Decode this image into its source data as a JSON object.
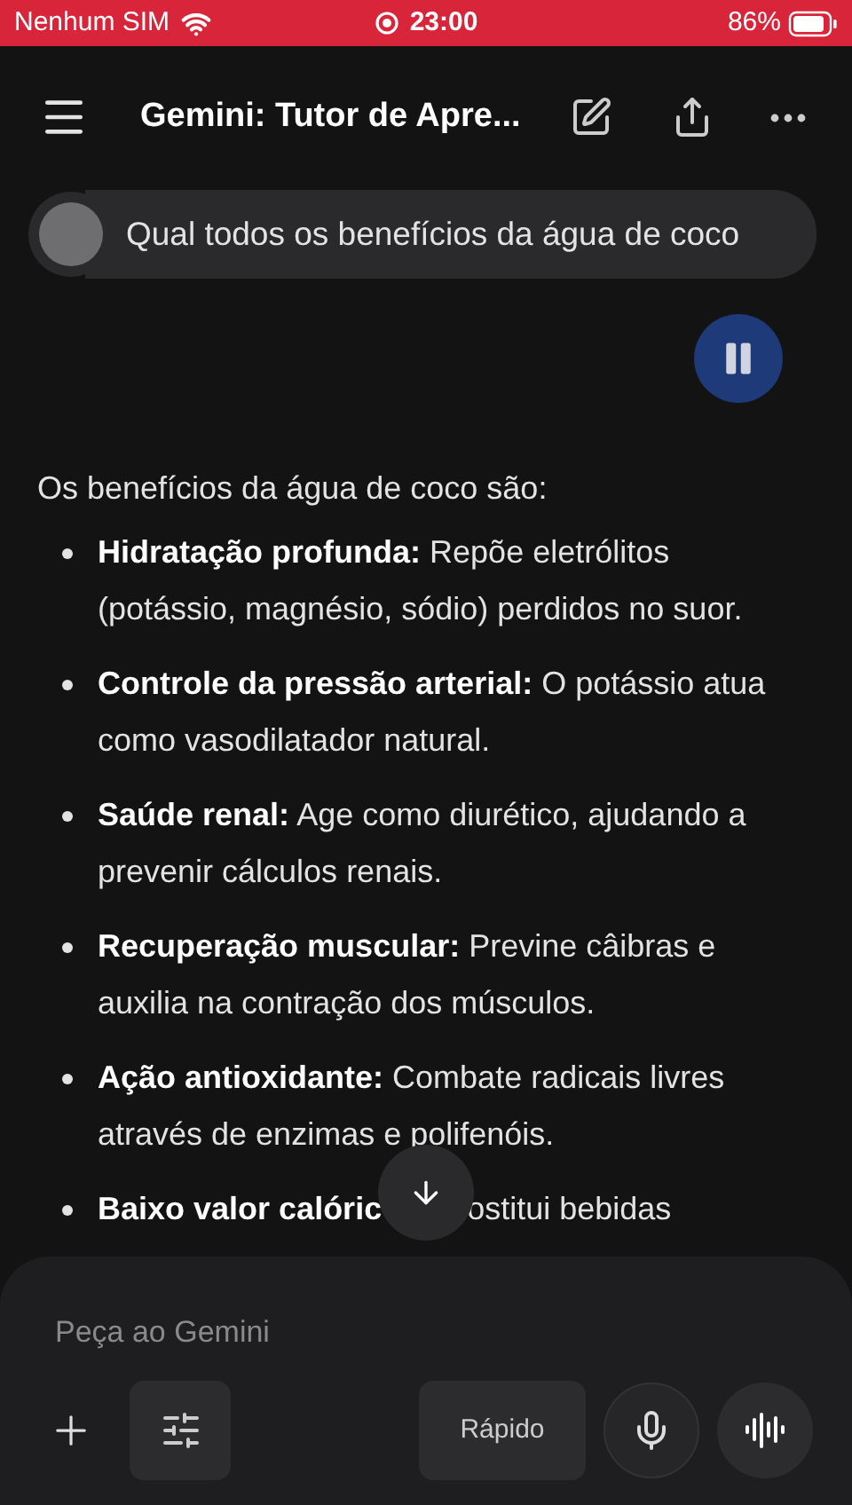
{
  "status_bar": {
    "carrier": "Nenhum SIM",
    "time": "23:00",
    "battery": "86%"
  },
  "header": {
    "title": "Gemini: Tutor de Apre..."
  },
  "user_message": {
    "text": "Qual todos os benefícios da água de coco"
  },
  "answer": {
    "intro": "Os benefícios da água de coco são:",
    "items": [
      {
        "kind": "full",
        "bold": "Hidratação profunda:",
        "text": "Repõe eletrólitos (potássio, magnésio, sódio) perdidos no suor."
      },
      {
        "kind": "full",
        "bold": "Controle da pressão arterial:",
        "text": "O potássio atua como vasodilatador natural."
      },
      {
        "kind": "full",
        "bold": "Saúde renal:",
        "text": "Age como diurético, ajudando a prevenir cálculos renais."
      },
      {
        "kind": "full",
        "bold": "Recuperação muscular:",
        "text": "Previne câibras e auxilia na contração dos músculos."
      },
      {
        "kind": "full",
        "bold": "Ação antioxidante:",
        "text": "Combate radicais livres através de enzimas e polifenóis."
      },
      {
        "kind": "covered",
        "bold": "Baixo valor calóric",
        "text": "ostitui bebidas"
      }
    ]
  },
  "composer": {
    "placeholder": "Peça ao Gemini",
    "mode": "Rápido"
  }
}
